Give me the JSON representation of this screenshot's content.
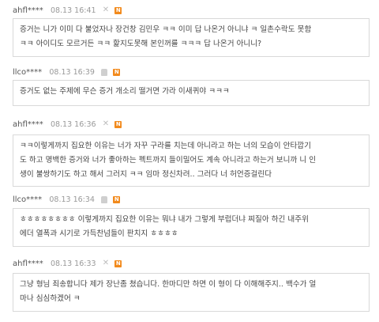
{
  "comments": [
    {
      "author": "ahfl****",
      "time": "08.13 16:41",
      "lines": [
        "증거는 니가 이미 다 불었자나 장건창 김민우 ㅋㅋ 이미 답 나온거 아니냐 ㅋ 일촌수락도 못함",
        "ㅋㅋ 아이디도 모르거든 ㅋㅋ 핥지도못해 본인꺼를 ㅋㅋㅋ 답 나온거 아니니?"
      ]
    },
    {
      "author": "llco****",
      "time": "08.13 16:39",
      "lines": [
        "증거도 없는 주제에 무슨 증거 개소리 떨거면 가라 이새퀴야 ㅋㅋㅋ"
      ]
    },
    {
      "author": "ahfl****",
      "time": "08.13 16:36",
      "lines": [
        "ㅋㅋ이렇게까지 집요한 이유는 너가 자꾸 구라를 치는데 아니라고 하는 너의 모습이 안타깝기",
        "도 하고 명백한 증거와 너가 좋아하는 펙트까지 들이밀어도 계속 아니라고 하는거 보니까 니 인",
        "생이 불쌍하기도 하고 해서 그러지 ㅋㅋ 임마 정신차려.. 그러다 너 허언증걸린다"
      ]
    },
    {
      "author": "llco****",
      "time": "08.13 16:34",
      "lines": [
        "ㅎㅎㅎㅎㅎㅎㅎㅎ 이렇게까지 집요한 이유는 뭐냐 내가 그렇게 부럽더냐 찌질아 하긴 내주위",
        "에더 열폭과 시기로 가득찬넘들이 판치지 ㅎㅎㅎㅎ"
      ]
    },
    {
      "author": "ahfl****",
      "time": "08.13 16:33",
      "lines": [
        "그냥 형님 죄송합니다 제가 장난좀 쳤습니다. 한마디만 하면 이 형이 다 이해해주지.. 백수가 얼",
        "마나 심심하겠어 ㅋ"
      ]
    }
  ],
  "icons": {
    "delete": "close-x-icon",
    "new": "new-badge-icon",
    "report": "report-alert-icon"
  },
  "colors": {
    "new_badge": "#f28a1c",
    "border": "#d9d9d9"
  }
}
